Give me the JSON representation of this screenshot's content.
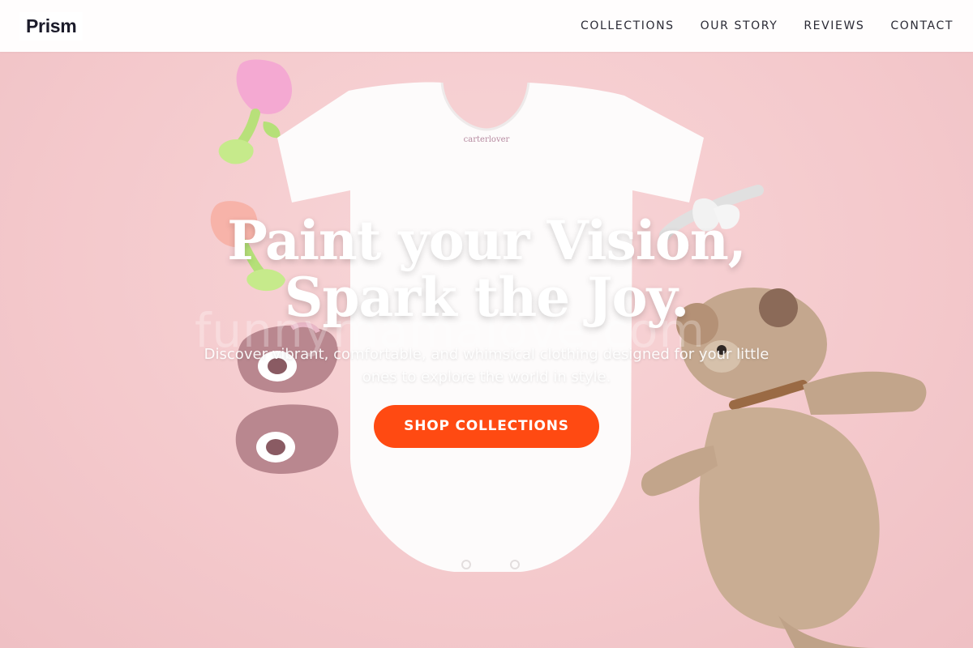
{
  "brand": {
    "name": "Prism"
  },
  "nav": {
    "items": [
      "COLLECTIONS",
      "OUR STORY",
      "REVIEWS",
      "CONTACT"
    ]
  },
  "hero": {
    "headline_line1": "Paint your Vision,",
    "headline_line2": "Spark the Joy.",
    "subtitle": "Discover vibrant, comfortable, and whimsical clothing designed for your little ones to explore the world in style.",
    "cta_label": "SHOP COLLECTIONS",
    "tag_text": "carterlover",
    "watermark_text": "funnymamalove.com"
  },
  "colors": {
    "accent": "#ff4a12",
    "background": "#f6cfd1",
    "nav_text": "#2a2a35"
  }
}
